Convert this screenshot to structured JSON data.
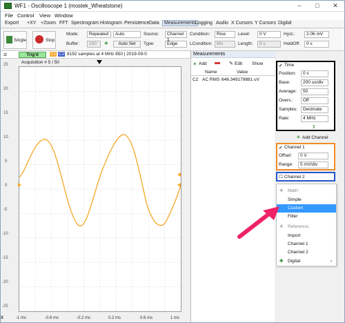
{
  "window": {
    "title": "WF1 - Oscilloscope 1 (mostek_Wheatstone)",
    "controls": [
      "–",
      "□",
      "✕"
    ]
  },
  "menu": [
    "File",
    "Control",
    "View",
    "Window"
  ],
  "tabs": [
    "Export",
    "+XY",
    "+Zoom",
    "FFT",
    "Spectrogram",
    "Histogram",
    "Persistence",
    "Data",
    "Measurements",
    "Logging",
    "Audio",
    "X Cursors",
    "Y Cursors",
    "Digital"
  ],
  "active_tab": "Measurements",
  "toolbar": {
    "single_label": "Single",
    "stop_label": "Stop",
    "mode_label": "Mode:",
    "mode_value": "Repeated",
    "auto_value": "Auto",
    "buffer_label": "Buffer:",
    "buffer_value": "100",
    "auto_set_label": "Auto Set",
    "source_label": "Source:",
    "source_value": "Channel 1",
    "type_label": "Type:",
    "type_value": "Edge",
    "condition_label": "Condition:",
    "condition_value": "Rise",
    "lcondition_label": "LCondition:",
    "lcondition_value": "Mo",
    "level_label": "Level:",
    "level_value": "0 V",
    "length_label": "Length:",
    "length_value": "0 s",
    "hyst_label": "Hyst.:",
    "hyst_value": "2.06 mV",
    "holdoff_label": "HoldOff:",
    "holdoff_value": "0 s"
  },
  "plot": {
    "trig_status": "Trig'd",
    "c1_tag": "C1",
    "c2_tag": "C2",
    "info_text": "8192 samples at 4 MHz 850 | 2019-09-0",
    "acquisition": "Acquisition # 5 / 50",
    "y_labels": [
      "25",
      "20",
      "15",
      "10",
      "5",
      "0",
      "-5",
      "-10",
      "-15",
      "-20",
      "-25"
    ],
    "x_labels": [
      "-1 ms",
      "-0.6 ms",
      "-0.2 ms",
      "0.2 ms",
      "0.6 ms",
      "1 ms"
    ],
    "x_unit": "X"
  },
  "measurements": {
    "header": "Measurements",
    "add_label": "Add",
    "edit_label": "Edit",
    "show_label": "Show",
    "col_name": "Name",
    "col_value": "Value",
    "rows": [
      {
        "ch": "C2",
        "name": "AC RMS",
        "value": "646.349179881 uV"
      }
    ]
  },
  "time_panel": {
    "title": "Time",
    "position_label": "Position:",
    "position_value": "0 s",
    "base_label": "Base:",
    "base_value": "200 us/div",
    "average_label": "Average:",
    "average_value": "50",
    "overs_label": "Overs.:",
    "overs_value": "Off",
    "samples_label": "Samples:",
    "samples_value": "Decimate",
    "rate_label": "Rate:",
    "rate_value": "4 MHz"
  },
  "add_channel_label": "Add Channel",
  "channel1": {
    "title": "Channel 1",
    "offset_label": "Offset:",
    "offset_value": "0 V",
    "range_label": "Range:",
    "range_value": "5 mV/div"
  },
  "channel2": {
    "title": "Channel 2"
  },
  "dropdown": {
    "math_header": "Math:",
    "simple": "Simple",
    "custom": "Custom",
    "filter": "Filter",
    "reference_header": "Reference:",
    "import": "Import",
    "channel1": "Channel 1",
    "channel2": "Channel 2",
    "digital": "Digital"
  },
  "colors": {
    "channel1": "#f5a623",
    "time_box": "#000000",
    "channel1_box": "#f08a24",
    "channel2_box": "#2255cc",
    "arrow": "#ee2266",
    "highlight": "#3399ff"
  }
}
